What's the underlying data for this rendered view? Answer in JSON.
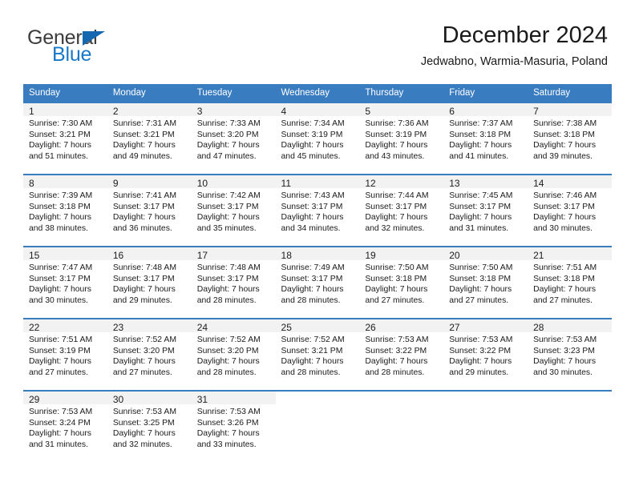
{
  "brand": {
    "name_part1": "General",
    "name_part2": "Blue",
    "triangle_icon": "triangle-icon",
    "color_dark": "#3c3c3c",
    "color_blue": "#1878c8"
  },
  "header": {
    "title": "December 2024",
    "subtitle": "Jedwabno, Warmia-Masuria, Poland"
  },
  "calendar": {
    "accent_color": "#3a7cc0",
    "daynum_background": "#f2f2f2",
    "weekday_headers": [
      "Sunday",
      "Monday",
      "Tuesday",
      "Wednesday",
      "Thursday",
      "Friday",
      "Saturday"
    ],
    "weeks": [
      [
        {
          "day": "1",
          "sunrise": "Sunrise: 7:30 AM",
          "sunset": "Sunset: 3:21 PM",
          "daylight_line1": "Daylight: 7 hours",
          "daylight_line2": "and 51 minutes."
        },
        {
          "day": "2",
          "sunrise": "Sunrise: 7:31 AM",
          "sunset": "Sunset: 3:21 PM",
          "daylight_line1": "Daylight: 7 hours",
          "daylight_line2": "and 49 minutes."
        },
        {
          "day": "3",
          "sunrise": "Sunrise: 7:33 AM",
          "sunset": "Sunset: 3:20 PM",
          "daylight_line1": "Daylight: 7 hours",
          "daylight_line2": "and 47 minutes."
        },
        {
          "day": "4",
          "sunrise": "Sunrise: 7:34 AM",
          "sunset": "Sunset: 3:19 PM",
          "daylight_line1": "Daylight: 7 hours",
          "daylight_line2": "and 45 minutes."
        },
        {
          "day": "5",
          "sunrise": "Sunrise: 7:36 AM",
          "sunset": "Sunset: 3:19 PM",
          "daylight_line1": "Daylight: 7 hours",
          "daylight_line2": "and 43 minutes."
        },
        {
          "day": "6",
          "sunrise": "Sunrise: 7:37 AM",
          "sunset": "Sunset: 3:18 PM",
          "daylight_line1": "Daylight: 7 hours",
          "daylight_line2": "and 41 minutes."
        },
        {
          "day": "7",
          "sunrise": "Sunrise: 7:38 AM",
          "sunset": "Sunset: 3:18 PM",
          "daylight_line1": "Daylight: 7 hours",
          "daylight_line2": "and 39 minutes."
        }
      ],
      [
        {
          "day": "8",
          "sunrise": "Sunrise: 7:39 AM",
          "sunset": "Sunset: 3:18 PM",
          "daylight_line1": "Daylight: 7 hours",
          "daylight_line2": "and 38 minutes."
        },
        {
          "day": "9",
          "sunrise": "Sunrise: 7:41 AM",
          "sunset": "Sunset: 3:17 PM",
          "daylight_line1": "Daylight: 7 hours",
          "daylight_line2": "and 36 minutes."
        },
        {
          "day": "10",
          "sunrise": "Sunrise: 7:42 AM",
          "sunset": "Sunset: 3:17 PM",
          "daylight_line1": "Daylight: 7 hours",
          "daylight_line2": "and 35 minutes."
        },
        {
          "day": "11",
          "sunrise": "Sunrise: 7:43 AM",
          "sunset": "Sunset: 3:17 PM",
          "daylight_line1": "Daylight: 7 hours",
          "daylight_line2": "and 34 minutes."
        },
        {
          "day": "12",
          "sunrise": "Sunrise: 7:44 AM",
          "sunset": "Sunset: 3:17 PM",
          "daylight_line1": "Daylight: 7 hours",
          "daylight_line2": "and 32 minutes."
        },
        {
          "day": "13",
          "sunrise": "Sunrise: 7:45 AM",
          "sunset": "Sunset: 3:17 PM",
          "daylight_line1": "Daylight: 7 hours",
          "daylight_line2": "and 31 minutes."
        },
        {
          "day": "14",
          "sunrise": "Sunrise: 7:46 AM",
          "sunset": "Sunset: 3:17 PM",
          "daylight_line1": "Daylight: 7 hours",
          "daylight_line2": "and 30 minutes."
        }
      ],
      [
        {
          "day": "15",
          "sunrise": "Sunrise: 7:47 AM",
          "sunset": "Sunset: 3:17 PM",
          "daylight_line1": "Daylight: 7 hours",
          "daylight_line2": "and 30 minutes."
        },
        {
          "day": "16",
          "sunrise": "Sunrise: 7:48 AM",
          "sunset": "Sunset: 3:17 PM",
          "daylight_line1": "Daylight: 7 hours",
          "daylight_line2": "and 29 minutes."
        },
        {
          "day": "17",
          "sunrise": "Sunrise: 7:48 AM",
          "sunset": "Sunset: 3:17 PM",
          "daylight_line1": "Daylight: 7 hours",
          "daylight_line2": "and 28 minutes."
        },
        {
          "day": "18",
          "sunrise": "Sunrise: 7:49 AM",
          "sunset": "Sunset: 3:17 PM",
          "daylight_line1": "Daylight: 7 hours",
          "daylight_line2": "and 28 minutes."
        },
        {
          "day": "19",
          "sunrise": "Sunrise: 7:50 AM",
          "sunset": "Sunset: 3:18 PM",
          "daylight_line1": "Daylight: 7 hours",
          "daylight_line2": "and 27 minutes."
        },
        {
          "day": "20",
          "sunrise": "Sunrise: 7:50 AM",
          "sunset": "Sunset: 3:18 PM",
          "daylight_line1": "Daylight: 7 hours",
          "daylight_line2": "and 27 minutes."
        },
        {
          "day": "21",
          "sunrise": "Sunrise: 7:51 AM",
          "sunset": "Sunset: 3:18 PM",
          "daylight_line1": "Daylight: 7 hours",
          "daylight_line2": "and 27 minutes."
        }
      ],
      [
        {
          "day": "22",
          "sunrise": "Sunrise: 7:51 AM",
          "sunset": "Sunset: 3:19 PM",
          "daylight_line1": "Daylight: 7 hours",
          "daylight_line2": "and 27 minutes."
        },
        {
          "day": "23",
          "sunrise": "Sunrise: 7:52 AM",
          "sunset": "Sunset: 3:20 PM",
          "daylight_line1": "Daylight: 7 hours",
          "daylight_line2": "and 27 minutes."
        },
        {
          "day": "24",
          "sunrise": "Sunrise: 7:52 AM",
          "sunset": "Sunset: 3:20 PM",
          "daylight_line1": "Daylight: 7 hours",
          "daylight_line2": "and 28 minutes."
        },
        {
          "day": "25",
          "sunrise": "Sunrise: 7:52 AM",
          "sunset": "Sunset: 3:21 PM",
          "daylight_line1": "Daylight: 7 hours",
          "daylight_line2": "and 28 minutes."
        },
        {
          "day": "26",
          "sunrise": "Sunrise: 7:53 AM",
          "sunset": "Sunset: 3:22 PM",
          "daylight_line1": "Daylight: 7 hours",
          "daylight_line2": "and 28 minutes."
        },
        {
          "day": "27",
          "sunrise": "Sunrise: 7:53 AM",
          "sunset": "Sunset: 3:22 PM",
          "daylight_line1": "Daylight: 7 hours",
          "daylight_line2": "and 29 minutes."
        },
        {
          "day": "28",
          "sunrise": "Sunrise: 7:53 AM",
          "sunset": "Sunset: 3:23 PM",
          "daylight_line1": "Daylight: 7 hours",
          "daylight_line2": "and 30 minutes."
        }
      ],
      [
        {
          "day": "29",
          "sunrise": "Sunrise: 7:53 AM",
          "sunset": "Sunset: 3:24 PM",
          "daylight_line1": "Daylight: 7 hours",
          "daylight_line2": "and 31 minutes."
        },
        {
          "day": "30",
          "sunrise": "Sunrise: 7:53 AM",
          "sunset": "Sunset: 3:25 PM",
          "daylight_line1": "Daylight: 7 hours",
          "daylight_line2": "and 32 minutes."
        },
        {
          "day": "31",
          "sunrise": "Sunrise: 7:53 AM",
          "sunset": "Sunset: 3:26 PM",
          "daylight_line1": "Daylight: 7 hours",
          "daylight_line2": "and 33 minutes."
        },
        {
          "day": "",
          "sunrise": "",
          "sunset": "",
          "daylight_line1": "",
          "daylight_line2": ""
        },
        {
          "day": "",
          "sunrise": "",
          "sunset": "",
          "daylight_line1": "",
          "daylight_line2": ""
        },
        {
          "day": "",
          "sunrise": "",
          "sunset": "",
          "daylight_line1": "",
          "daylight_line2": ""
        },
        {
          "day": "",
          "sunrise": "",
          "sunset": "",
          "daylight_line1": "",
          "daylight_line2": ""
        }
      ]
    ]
  }
}
